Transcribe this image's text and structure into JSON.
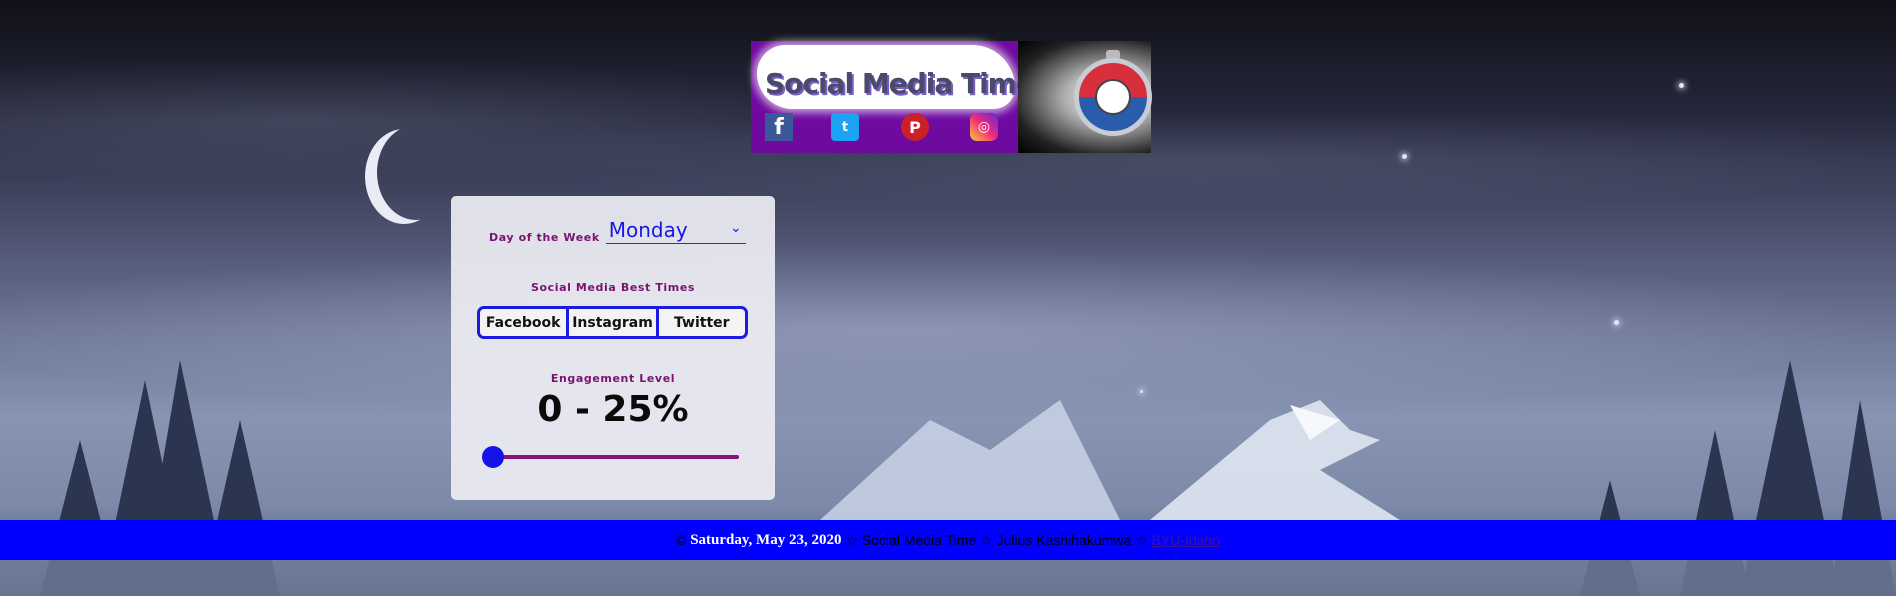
{
  "banner": {
    "title": "Social Media Time",
    "icons": [
      "facebook-icon",
      "twitter-icon",
      "pinterest-icon",
      "instagram-icon"
    ],
    "icon_glyphs": {
      "facebook": "f",
      "twitter": "t",
      "pinterest": "P",
      "instagram": "◎"
    }
  },
  "card": {
    "day_label": "Day of the Week",
    "day_value": "Monday",
    "best_times_label": "Social Media Best Times",
    "buttons": [
      {
        "label": "Facebook"
      },
      {
        "label": "Instagram"
      },
      {
        "label": "Twitter"
      }
    ],
    "engagement_label": "Engagement Level",
    "engagement_value": "0 - 25%",
    "slider_level": 0
  },
  "footer": {
    "copyright": "©",
    "date": "Saturday, May 23, 2020",
    "site": "Social Media Time",
    "author": "Julius Kashihakumwa",
    "school": "BYU-Idaho",
    "separator": "☆"
  },
  "colors": {
    "accent": "#1a1ae0",
    "label": "#7a1272",
    "footer_bg": "#0000ff",
    "banner_bg": "#6f0aa0"
  }
}
